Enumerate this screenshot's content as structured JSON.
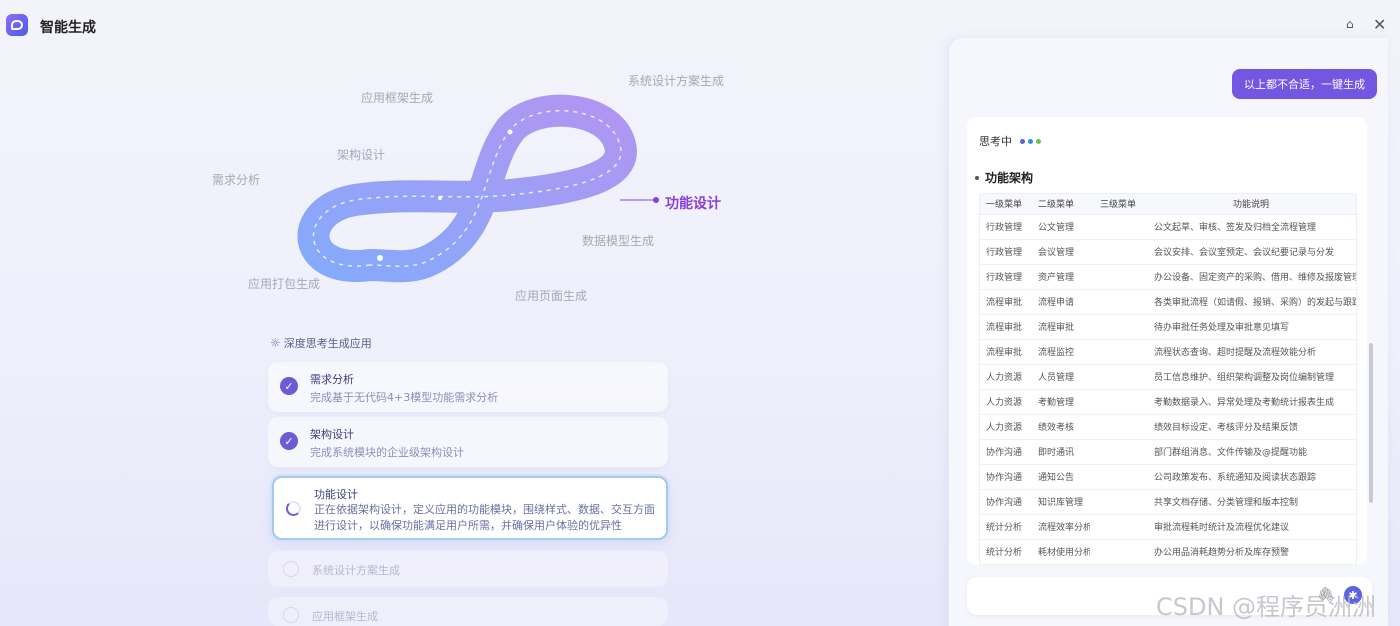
{
  "app": {
    "title": "智能生成"
  },
  "loop": {
    "labels": {
      "requirements": "需求分析",
      "architecture": "架构设计",
      "framework": "应用框架生成",
      "system_design": "系统设计方案生成",
      "function_design": "功能设计",
      "data_model": "数据模型生成",
      "page_gen": "应用页面生成",
      "packaging": "应用打包生成"
    }
  },
  "progress": {
    "heading": "深度思考生成应用",
    "steps": [
      {
        "title": "需求分析",
        "desc": "完成基于无代码4+3模型功能需求分析",
        "status": "done"
      },
      {
        "title": "架构设计",
        "desc": "完成系统模块的企业级架构设计",
        "status": "done"
      },
      {
        "title": "功能设计",
        "desc": "正在依据架构设计，定义应用的功能模块，围绕样式、数据、交互方面进行设计，以确保功能满足用户所需，并确保用户体验的优异性",
        "status": "active"
      },
      {
        "title": "系统设计方案生成",
        "status": "pending"
      },
      {
        "title": "应用框架生成",
        "status": "pending"
      }
    ]
  },
  "chat": {
    "user_message": "以上都不合适，一键生成",
    "thinking_label": "思考中",
    "dot_colors": [
      "#5a63e0",
      "#3b8af0",
      "#6cc24a"
    ],
    "section_title": "功能架构",
    "table": {
      "headers": [
        "一级菜单",
        "二级菜单",
        "三级菜单",
        "功能说明"
      ],
      "rows": [
        [
          "行政管理",
          "公文管理",
          "",
          "公文起草、审核、签发及归档全流程管理"
        ],
        [
          "行政管理",
          "会议管理",
          "",
          "会议安排、会议室预定、会议纪要记录与分发"
        ],
        [
          "行政管理",
          "资产管理",
          "",
          "办公设备、固定资产的采购、借用、维修及报废管理"
        ],
        [
          "流程审批",
          "流程申请",
          "",
          "各类审批流程（如请假、报销、采购）的发起与跟踪"
        ],
        [
          "流程审批",
          "流程审批",
          "",
          "待办审批任务处理及审批意见填写"
        ],
        [
          "流程审批",
          "流程监控",
          "",
          "流程状态查询、超时提醒及流程效能分析"
        ],
        [
          "人力资源",
          "人员管理",
          "",
          "员工信息维护、组织架构调整及岗位编制管理"
        ],
        [
          "人力资源",
          "考勤管理",
          "",
          "考勤数据录入、异常处理及考勤统计报表生成"
        ],
        [
          "人力资源",
          "绩效考核",
          "",
          "绩效目标设定、考核评分及结果反馈"
        ],
        [
          "协作沟通",
          "即时通讯",
          "",
          "部门群组消息、文件传输及@提醒功能"
        ],
        [
          "协作沟通",
          "通知公告",
          "",
          "公司政策发布、系统通知及阅读状态跟踪"
        ],
        [
          "协作沟通",
          "知识库管理",
          "",
          "共享文档存储、分类管理和版本控制"
        ],
        [
          "统计分析",
          "流程效率分析",
          "",
          "审批流程耗时统计及流程优化建议"
        ],
        [
          "统计分析",
          "耗材使用分析",
          "",
          "办公用品消耗趋势分析及库存预警"
        ]
      ]
    }
  },
  "watermark": "CSDN @程序员洲洲"
}
